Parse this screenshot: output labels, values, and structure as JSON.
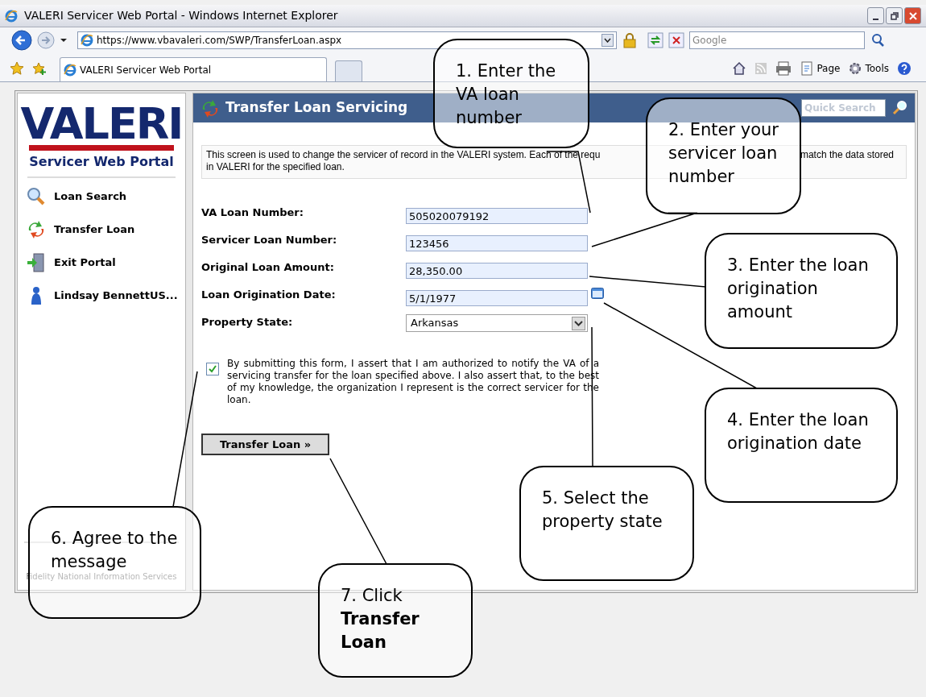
{
  "window": {
    "title": "VALERI Servicer Web Portal - Windows Internet Explorer"
  },
  "browser": {
    "address": "https://www.vbavaleri.com/SWP/TransferLoan.aspx",
    "search_placeholder": "Google",
    "tab": "VALERI Servicer Web Portal",
    "tools": [
      "Page",
      "Tools"
    ]
  },
  "sidebar": {
    "logo": "VALERI",
    "subtitle": "Servicer Web Portal",
    "items": [
      {
        "label": "Loan Search",
        "kind": "search"
      },
      {
        "label": "Transfer Loan",
        "kind": "transfer"
      },
      {
        "label": "Exit Portal",
        "kind": "exit"
      },
      {
        "label": "Lindsay BennettUS...",
        "kind": "user"
      }
    ],
    "footer": "Fidelity National Information Services"
  },
  "main": {
    "title": "Transfer Loan Servicing",
    "quick_search_placeholder": "Quick Search",
    "description": [
      "This screen is used to change the servicer of record in the VALERI system. Each of the requ",
      "match the data stored",
      "in VALERI for the specified loan."
    ],
    "fields": [
      {
        "label": "VA Loan Number:",
        "value": "505020079192",
        "kind": "text"
      },
      {
        "label": "Servicer Loan Number:",
        "value": "123456",
        "kind": "text"
      },
      {
        "label": "Original Loan Amount:",
        "value": "28,350.00",
        "kind": "text"
      },
      {
        "label": "Loan Origination Date:",
        "value": "5/1/1977",
        "kind": "date"
      },
      {
        "label": "Property State:",
        "value": "Arkansas",
        "kind": "select"
      }
    ],
    "consent": {
      "checked": true,
      "text": "By submitting this form, I assert that I am authorized to notify the VA of a servicing transfer for the loan specified above. I also assert that, to the best of my knowledge, the organization I represent is the correct servicer for the loan."
    },
    "button": "Transfer Loan »"
  },
  "callouts": [
    {
      "text": "1. Enter the VA loan number"
    },
    {
      "text": "2. Enter your servicer loan number"
    },
    {
      "text": "3. Enter the loan origination amount"
    },
    {
      "text": "4. Enter the loan origination date"
    },
    {
      "text": "5. Select the property state"
    },
    {
      "text": "6. Agree to the message"
    },
    {
      "text": "7. Click **Transfer Loan**"
    }
  ]
}
